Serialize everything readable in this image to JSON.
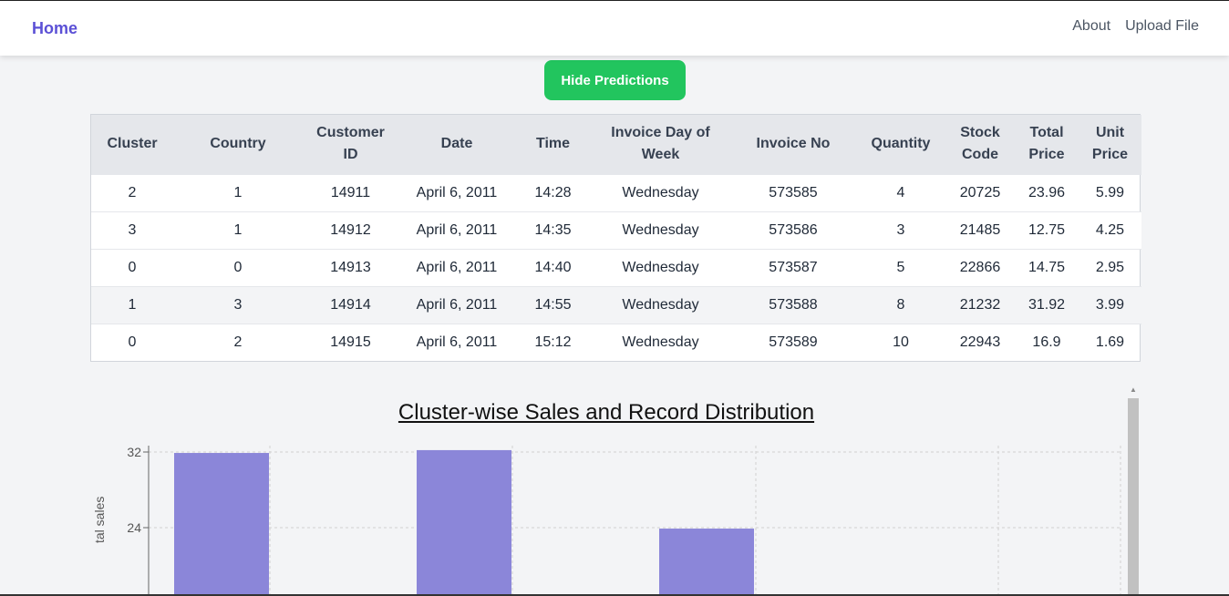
{
  "nav": {
    "home": "Home",
    "links": [
      "About",
      "Upload File"
    ]
  },
  "actions": {
    "hide_predictions": "Hide Predictions"
  },
  "table": {
    "headers": [
      "Cluster",
      "Country",
      "Customer ID",
      "Date",
      "Time",
      "Invoice Day of Week",
      "Invoice No",
      "Quantity",
      "Stock Code",
      "Total Price",
      "Unit Price"
    ],
    "rows": [
      [
        "2",
        "1",
        "14911",
        "April 6, 2011",
        "14:28",
        "Wednesday",
        "573585",
        "4",
        "20725",
        "23.96",
        "5.99"
      ],
      [
        "3",
        "1",
        "14912",
        "April 6, 2011",
        "14:35",
        "Wednesday",
        "573586",
        "3",
        "21485",
        "12.75",
        "4.25"
      ],
      [
        "0",
        "0",
        "14913",
        "April 6, 2011",
        "14:40",
        "Wednesday",
        "573587",
        "5",
        "22866",
        "14.75",
        "2.95"
      ],
      [
        "1",
        "3",
        "14914",
        "April 6, 2011",
        "14:55",
        "Wednesday",
        "573588",
        "8",
        "21232",
        "31.92",
        "3.99"
      ],
      [
        "0",
        "2",
        "14915",
        "April 6, 2011",
        "15:12",
        "Wednesday",
        "573589",
        "10",
        "22943",
        "16.9",
        "1.69"
      ]
    ]
  },
  "chart_data": {
    "type": "bar",
    "title": "Cluster-wise Sales and Record Distribution",
    "ylabel": "tal sales",
    "yticks": [
      "32",
      "24"
    ],
    "yvalues": [
      32,
      24
    ],
    "values": [
      31.9,
      32.2,
      23.9
    ],
    "bar_color": "#8b86d9",
    "grid": true
  }
}
